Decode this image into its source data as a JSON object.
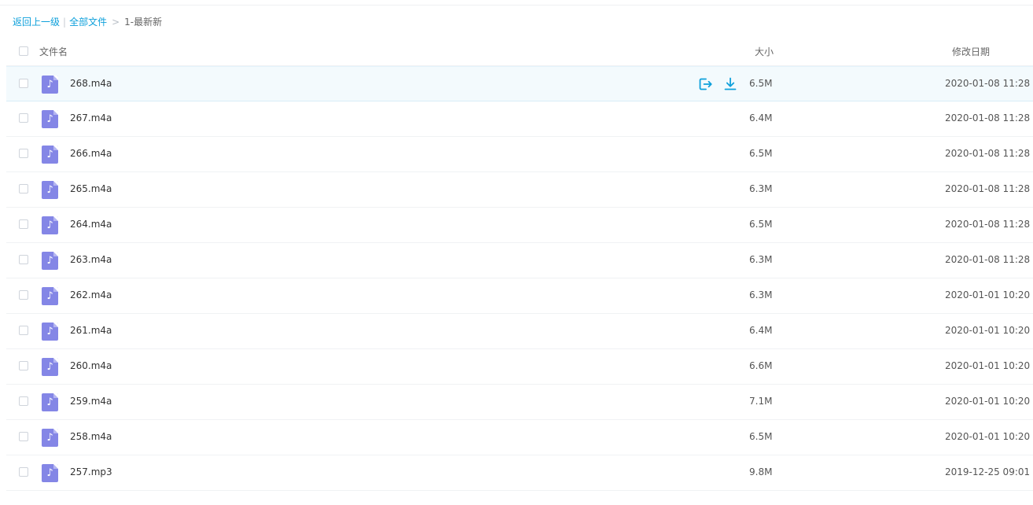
{
  "breadcrumb": {
    "back": "返回上一级",
    "separator": "|",
    "all_files": "全部文件",
    "arrow": ">",
    "current": "1-最新新"
  },
  "table": {
    "headers": {
      "name": "文件名",
      "size": "大小",
      "date": "修改日期"
    },
    "rows": [
      {
        "name": "268.m4a",
        "size": "6.5M",
        "date": "2020-01-08 11:28"
      },
      {
        "name": "267.m4a",
        "size": "6.4M",
        "date": "2020-01-08 11:28"
      },
      {
        "name": "266.m4a",
        "size": "6.5M",
        "date": "2020-01-08 11:28"
      },
      {
        "name": "265.m4a",
        "size": "6.3M",
        "date": "2020-01-08 11:28"
      },
      {
        "name": "264.m4a",
        "size": "6.5M",
        "date": "2020-01-08 11:28"
      },
      {
        "name": "263.m4a",
        "size": "6.3M",
        "date": "2020-01-08 11:28"
      },
      {
        "name": "262.m4a",
        "size": "6.3M",
        "date": "2020-01-01 10:20"
      },
      {
        "name": "261.m4a",
        "size": "6.4M",
        "date": "2020-01-01 10:20"
      },
      {
        "name": "260.m4a",
        "size": "6.6M",
        "date": "2020-01-01 10:20"
      },
      {
        "name": "259.m4a",
        "size": "7.1M",
        "date": "2020-01-01 10:20"
      },
      {
        "name": "258.m4a",
        "size": "6.5M",
        "date": "2020-01-01 10:20"
      },
      {
        "name": "257.mp3",
        "size": "9.8M",
        "date": "2019-12-25 09:01"
      }
    ],
    "file_icon_glyph": "♪",
    "file_icon_name": "audio-file-icon",
    "row_action_icons": [
      "share-icon",
      "download-icon"
    ]
  },
  "colors": {
    "link": "#0ea0db",
    "audio_icon": "#8486e6",
    "hover_row": "#f3fafd"
  }
}
